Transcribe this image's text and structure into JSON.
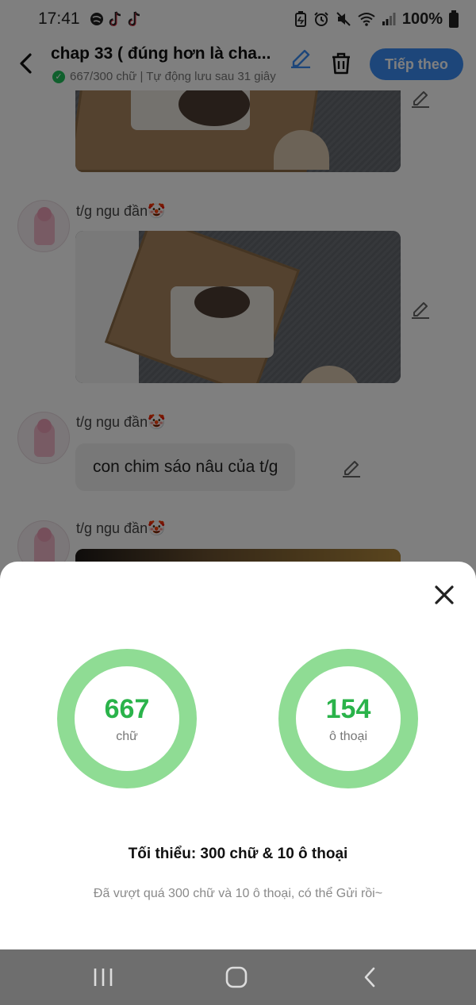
{
  "status_bar": {
    "time": "17:41",
    "battery": "100%"
  },
  "header": {
    "title": "chap 33 ( đúng hơn là cha...",
    "subtitle": "667/300 chữ | Tự động lưu sau 31 giây",
    "next_label": "Tiếp theo"
  },
  "chat": {
    "messages": [
      {
        "sender": "t/g ngu đần🤡",
        "type": "image"
      },
      {
        "sender": "t/g ngu đần🤡",
        "type": "text",
        "text": "con chim sáo nâu của t/g"
      },
      {
        "sender": "t/g ngu đần🤡",
        "type": "image"
      }
    ]
  },
  "stats": {
    "words_value": "667",
    "words_unit": "chữ",
    "dialogs_value": "154",
    "dialogs_unit": "ô thoại",
    "minimum": "Tối thiểu: 300 chữ & 10 ô thoại",
    "hint": "Đã vượt quá 300 chữ và 10 ô thoại, có thể Gửi rồi~"
  },
  "colors": {
    "accent": "#3a8cf5",
    "ring": "#8fdc94",
    "ring_text": "#2ab34a",
    "saved_check": "#21c05a"
  },
  "icons": [
    "back-arrow-icon",
    "pencil-icon",
    "trash-icon",
    "check-icon",
    "close-icon",
    "nav-recent-icon",
    "nav-home-icon",
    "nav-back-icon"
  ]
}
